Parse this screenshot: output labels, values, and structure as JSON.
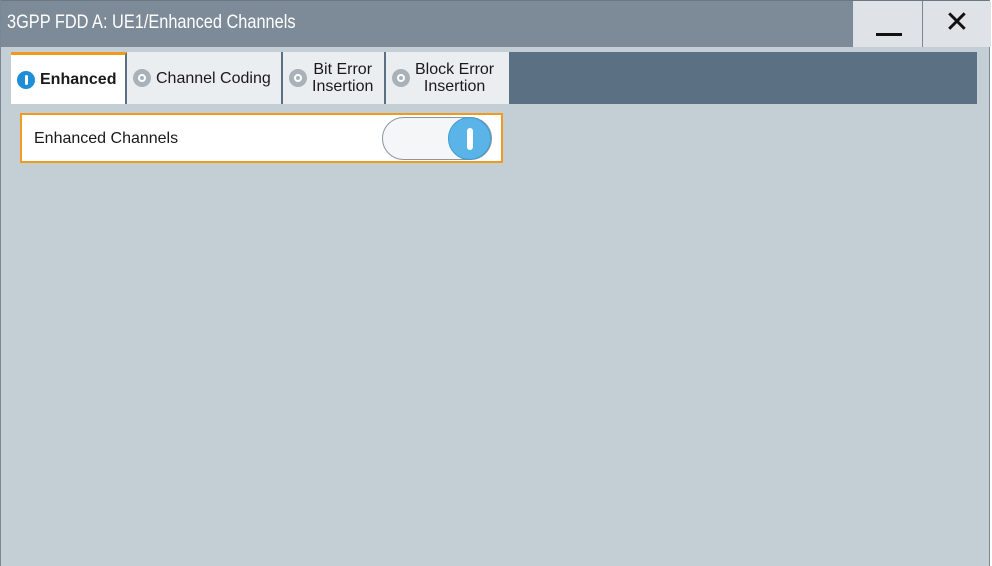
{
  "window": {
    "title": "3GPP FDD A: UE1/Enhanced Channels",
    "minimize_icon": "minimize-icon",
    "close_icon": "close-icon",
    "close_glyph": "✕"
  },
  "tabs": [
    {
      "label": "Enhanced",
      "state": "on",
      "active": true
    },
    {
      "label": "Channel Coding",
      "state": "off",
      "active": false
    },
    {
      "label_line1": "Bit Error",
      "label_line2": "Insertion",
      "state": "off",
      "active": false
    },
    {
      "label_line1": "Block Error",
      "label_line2": "Insertion",
      "state": "off",
      "active": false
    }
  ],
  "panel": {
    "label": "Enhanced Channels",
    "toggle_state": "on"
  },
  "colors": {
    "accent": "#f29a1e",
    "led_on": "#1e8fd5",
    "toggle_on": "#5ab4e8",
    "titlebar": "#7d8a98",
    "tabbar": "#5b7183",
    "background": "#c4cfd5"
  }
}
